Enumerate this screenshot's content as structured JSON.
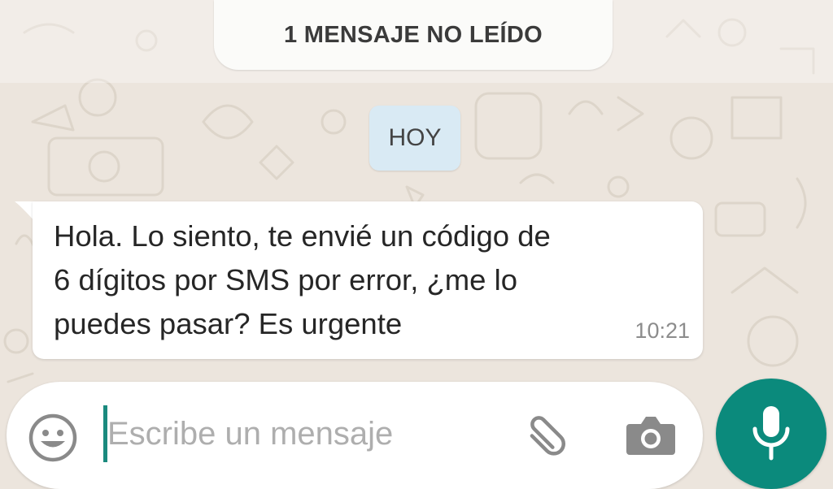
{
  "banner": {
    "unread_label": "1 MENSAJE NO LEÍDO"
  },
  "date_chip": {
    "label": "HOY"
  },
  "message": {
    "lines": [
      "Hola. Lo siento, te envié un código de",
      "6 dígitos por SMS por error, ¿me lo",
      "puedes pasar? Es urgente"
    ],
    "time": "10:21"
  },
  "composer": {
    "placeholder": "Escribe un mensaje",
    "value": "",
    "icons": {
      "emoji": "smiley-icon",
      "attach": "paperclip-icon",
      "camera": "camera-icon",
      "send": "microphone-icon"
    }
  },
  "colors": {
    "wallpaper": "#ece5dd",
    "bubble": "#ffffff",
    "date_chip": "#d9eaf4",
    "accent": "#0b8a7c",
    "time_text": "#8c8c8c"
  }
}
